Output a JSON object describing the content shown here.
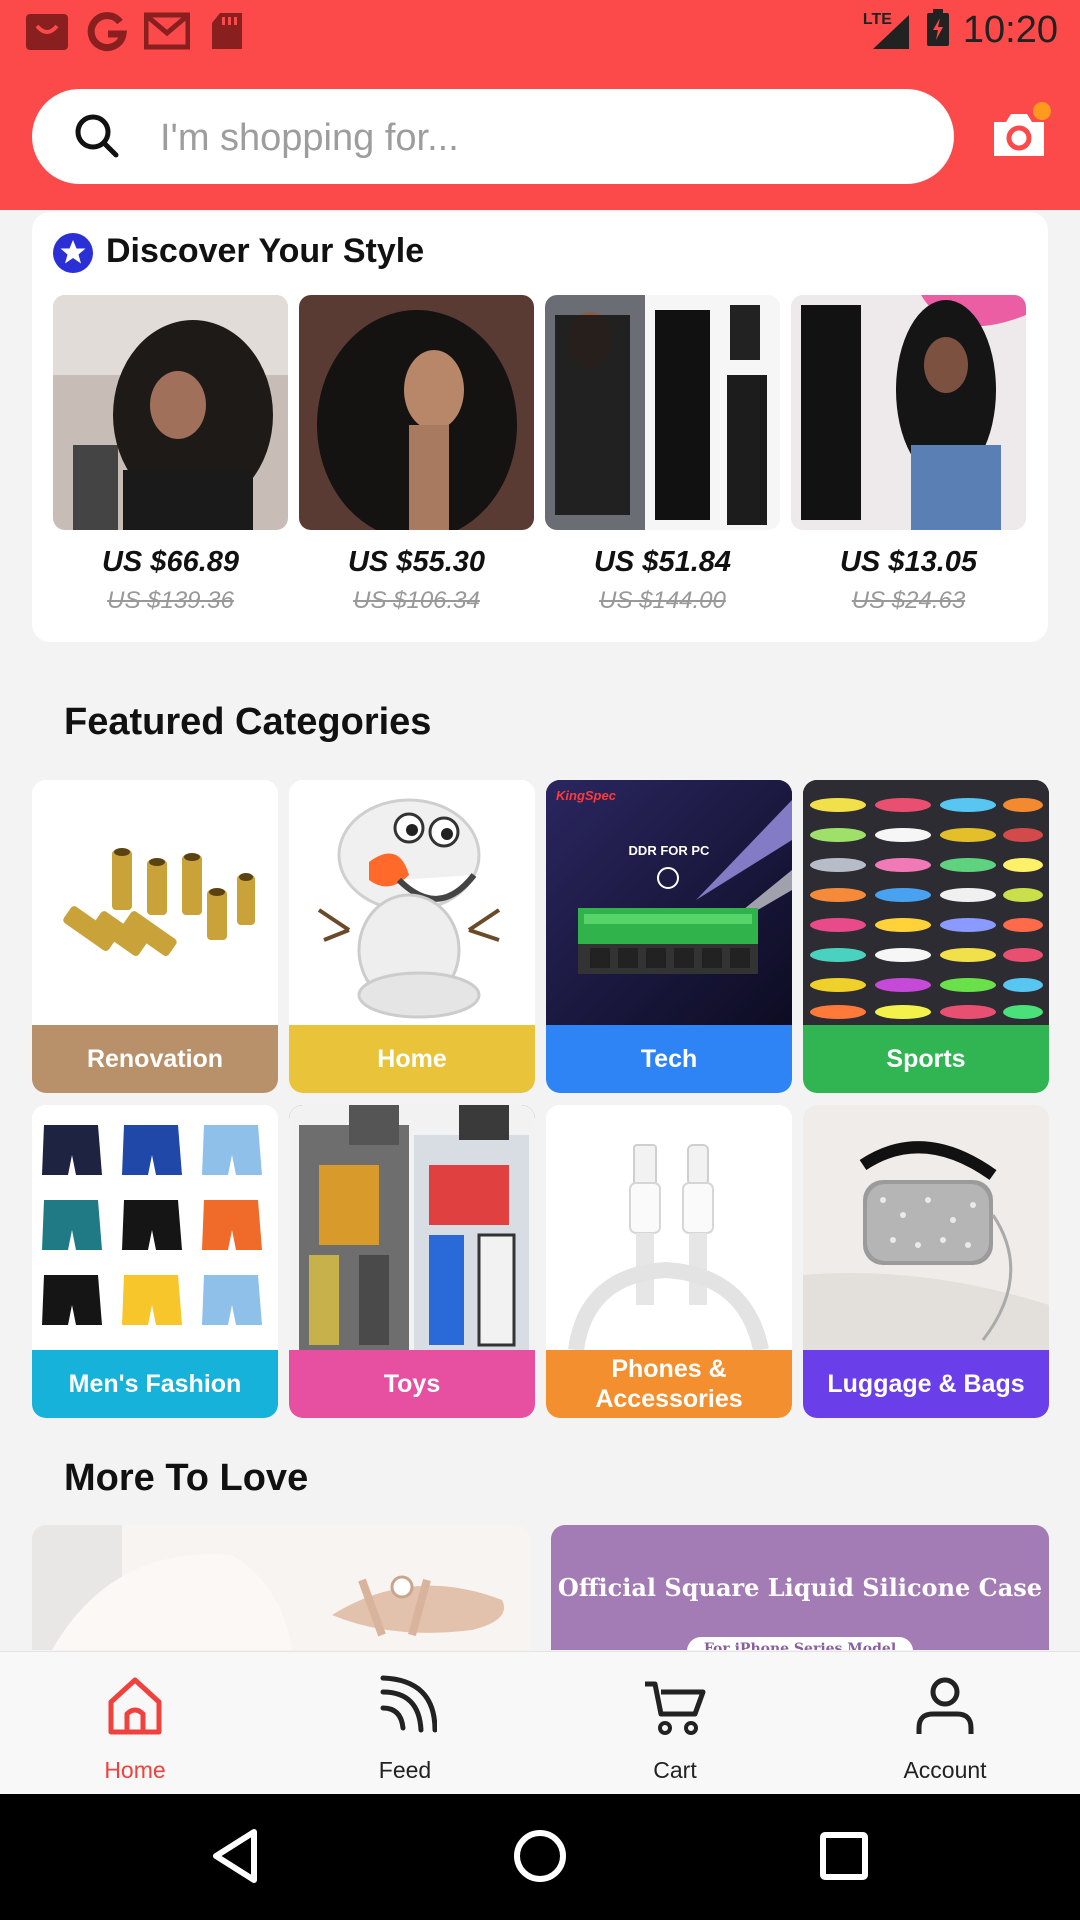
{
  "status_bar": {
    "time": "10:20",
    "network": "LTE",
    "left_icons": [
      "shop-icon",
      "google-icon",
      "gmail-icon",
      "sd-card-icon"
    ]
  },
  "search": {
    "placeholder": "I'm shopping for..."
  },
  "discover": {
    "title": "Discover Your Style",
    "products": [
      {
        "price": "US $66.89",
        "old_price": "US $139.36"
      },
      {
        "price": "US $55.30",
        "old_price": "US $106.34"
      },
      {
        "price": "US $51.84",
        "old_price": "US $144.00"
      },
      {
        "price": "US $13.05",
        "old_price": "US $24.63"
      }
    ]
  },
  "featured": {
    "title": "Featured Categories",
    "categories": [
      {
        "label": "Renovation",
        "color": "#b8906a"
      },
      {
        "label": "Home",
        "color": "#e9c43a"
      },
      {
        "label": "Tech",
        "color": "#2f84f5"
      },
      {
        "label": "Sports",
        "color": "#30b552"
      },
      {
        "label": "Men's Fashion",
        "color": "#17b2d9"
      },
      {
        "label": "Toys",
        "color": "#e74fa0"
      },
      {
        "label": "Phones & Accessories",
        "color": "#f48f2f"
      },
      {
        "label": "Luggage & Bags",
        "color": "#6a3ee8"
      }
    ],
    "tech_image_text": {
      "brand": "KingSpec",
      "caption": "DDR FOR PC"
    }
  },
  "more_to_love": {
    "title": "More To Love",
    "banner_text": "Official Square Liquid Silicone Case",
    "banner_subtext": "For iPhone Series Model"
  },
  "bottom_nav": {
    "items": [
      {
        "label": "Home",
        "icon": "home-icon",
        "active": true
      },
      {
        "label": "Feed",
        "icon": "feed-icon",
        "active": false
      },
      {
        "label": "Cart",
        "icon": "cart-icon",
        "active": false
      },
      {
        "label": "Account",
        "icon": "account-icon",
        "active": false
      }
    ]
  },
  "colors": {
    "header_red": "#fc4a4a",
    "accent_red": "#f0413c"
  }
}
